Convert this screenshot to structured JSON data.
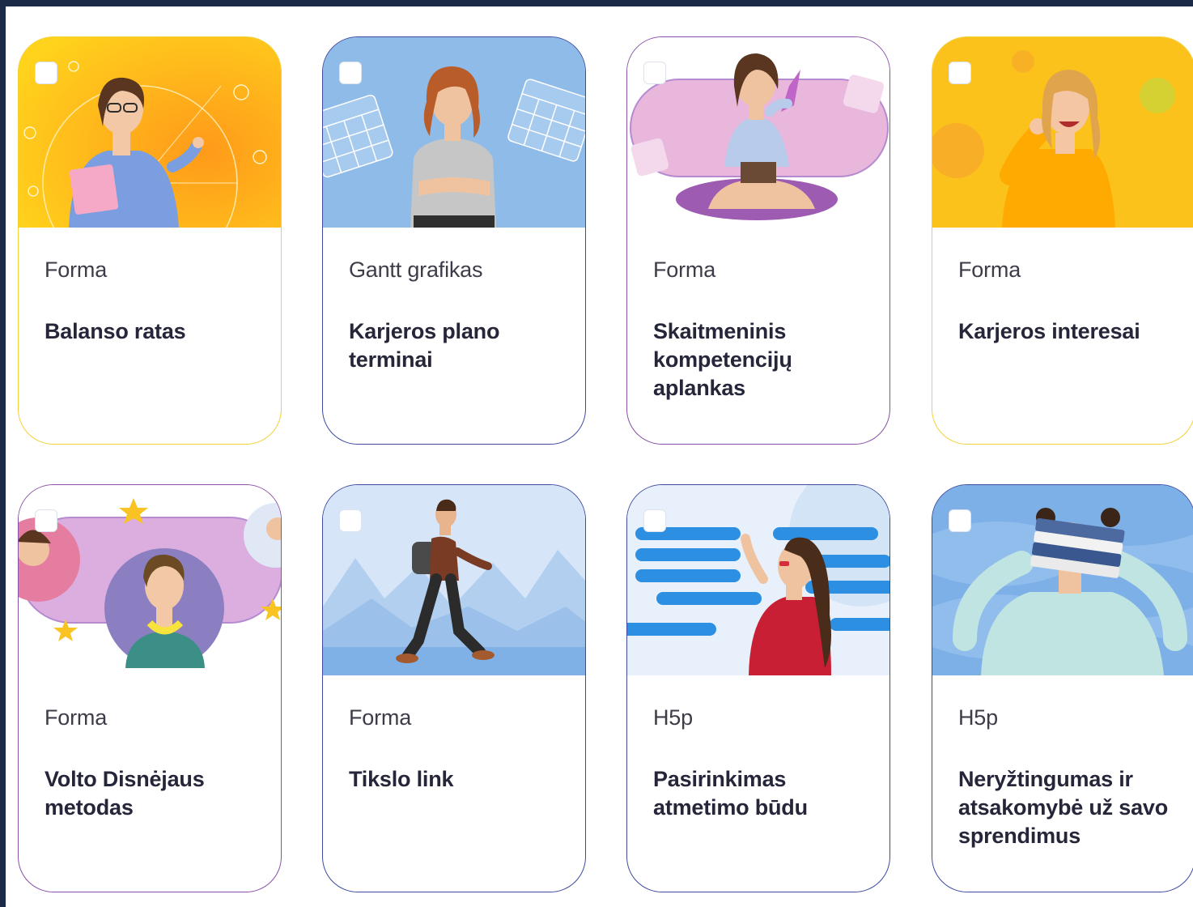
{
  "cards": [
    {
      "type": "Forma",
      "title": "Balanso ratas",
      "border": "#f2d13a",
      "bg": "#fbb81a"
    },
    {
      "type": "Gantt grafikas",
      "title": "Karjeros plano terminai",
      "border": "#3d4aa0",
      "bg": "#8fbbe8"
    },
    {
      "type": "Forma",
      "title": "Skaitmeninis kompetencijų aplankas",
      "border": "#8a4fa7",
      "bg": "#ffffff"
    },
    {
      "type": "Forma",
      "title": "Karjeros interesai",
      "border": "#f2d13a",
      "bg": "#fbbd1c"
    },
    {
      "type": "Forma",
      "title": "Volto Disnėjaus metodas",
      "border": "#8a4fa7",
      "bg": "#ffffff"
    },
    {
      "type": "Forma",
      "title": "Tikslo link",
      "border": "#3d4aa0",
      "bg": "#d6e6f8"
    },
    {
      "type": "H5p",
      "title": "Pasirinkimas atmetimo būdu",
      "border": "#3d4aa0",
      "bg": "#e7f0fb"
    },
    {
      "type": "H5p",
      "title": "Neryžtingumas ir atsakomybė už savo sprendimus",
      "border": "#3d4aa0",
      "bg": "#7eb0e8"
    }
  ]
}
